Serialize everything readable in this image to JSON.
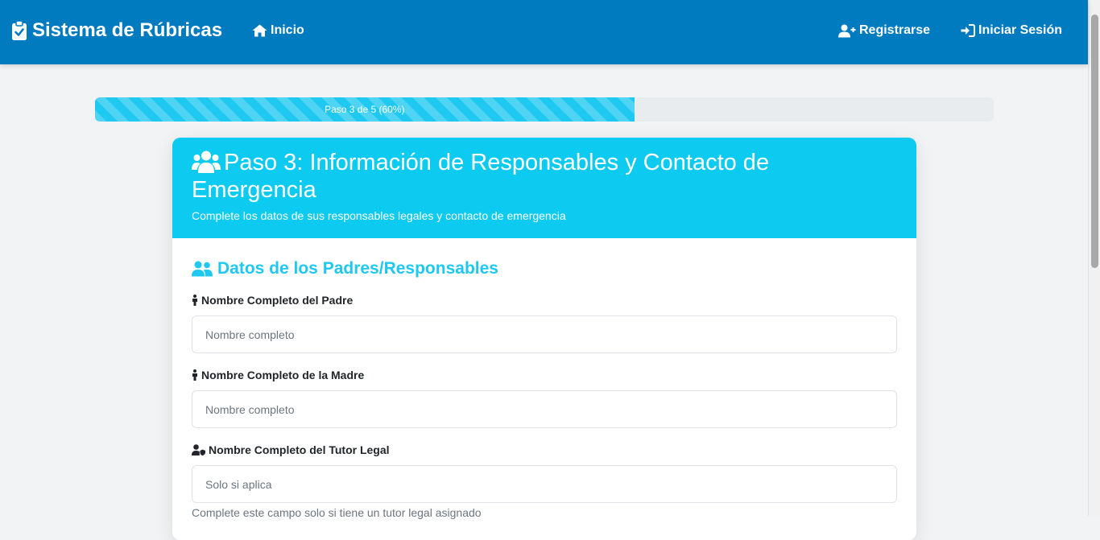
{
  "nav": {
    "brand": "Sistema de Rúbricas",
    "home": "Inicio",
    "register": "Registrarse",
    "login": "Iniciar Sesión"
  },
  "progress": {
    "label": "Paso 3 de 5 (60%)",
    "percent": 60
  },
  "card": {
    "title": "Paso 3: Información de Responsables y Contacto de Emergencia",
    "subtitle": "Complete los datos de sus responsables legales y contacto de emergencia"
  },
  "section": {
    "title": "Datos de los Padres/Responsables"
  },
  "fields": {
    "father": {
      "label": "Nombre Completo del Padre",
      "placeholder": "Nombre completo",
      "value": ""
    },
    "mother": {
      "label": "Nombre Completo de la Madre",
      "placeholder": "Nombre completo",
      "value": ""
    },
    "tutor": {
      "label": "Nombre Completo del Tutor Legal",
      "placeholder": "Solo si aplica",
      "value": "",
      "help": "Complete este campo solo si tiene un tutor legal asignado"
    }
  },
  "colors": {
    "navbar": "#007bbf",
    "accent": "#0dcaf0",
    "progress_fill": "#1ec8f0"
  }
}
